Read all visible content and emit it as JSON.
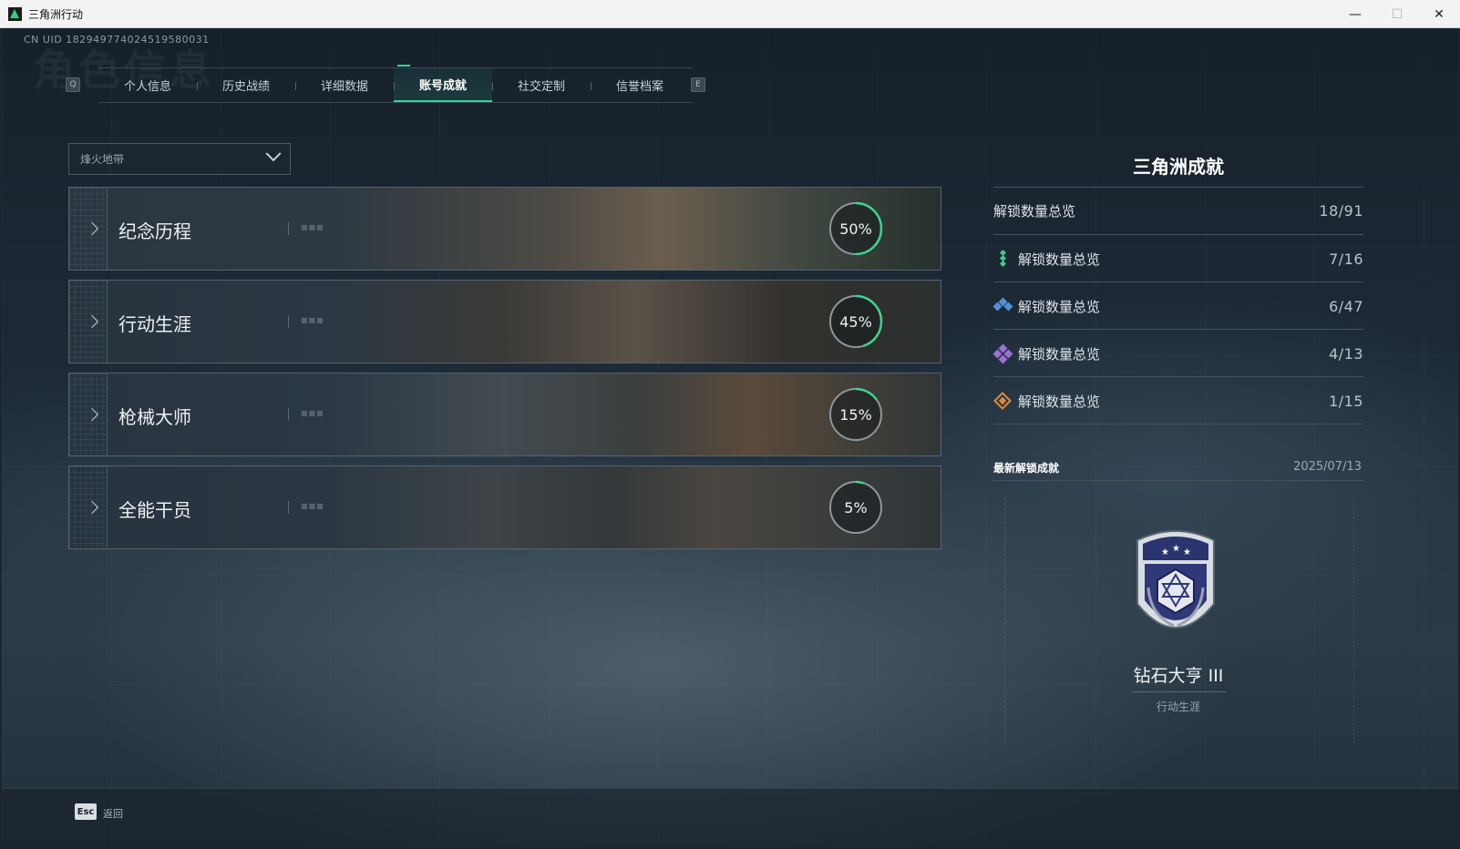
{
  "window": {
    "title": "三角洲行动",
    "minimize": "—",
    "maximize": "☐",
    "close": "✕"
  },
  "header": {
    "uid": "CN UID 182949774024519580031",
    "watermark": "角色信息",
    "key_left": "Q",
    "key_right": "E"
  },
  "tabs": [
    {
      "label": "个人信息",
      "active": false
    },
    {
      "label": "历史战绩",
      "active": false
    },
    {
      "label": "详细数据",
      "active": false
    },
    {
      "label": "账号成就",
      "active": true
    },
    {
      "label": "社交定制",
      "active": false
    },
    {
      "label": "信誉档案",
      "active": false
    }
  ],
  "filter": {
    "selected": "烽火地带"
  },
  "categories": [
    {
      "label": "纪念历程",
      "percent_text": "50%",
      "progress": 0.5
    },
    {
      "label": "行动生涯",
      "percent_text": "45%",
      "progress": 0.45
    },
    {
      "label": "枪械大师",
      "percent_text": "15%",
      "progress": 0.15
    },
    {
      "label": "全能干员",
      "percent_text": "5%",
      "progress": 0.05
    }
  ],
  "summary": {
    "title": "三角洲成就",
    "total": {
      "label": "解锁数量总览",
      "value": "18/91"
    },
    "tiers": [
      {
        "label": "解锁数量总览",
        "value": "7/16",
        "color": "#3ec98a",
        "icon": "green-gem-icon"
      },
      {
        "label": "解锁数量总览",
        "value": "6/47",
        "color": "#4f8fd6",
        "icon": "blue-gem-icon"
      },
      {
        "label": "解锁数量总览",
        "value": "4/13",
        "color": "#9c6fd6",
        "icon": "purple-gem-icon"
      },
      {
        "label": "解锁数量总览",
        "value": "1/15",
        "color": "#e08a3c",
        "icon": "orange-gem-icon"
      }
    ]
  },
  "latest": {
    "title": "最新解锁成就",
    "date": "2025/07/13",
    "badge_name": "钻石大亨 III",
    "badge_category": "行动生涯"
  },
  "footer": {
    "esc_key": "Esc",
    "back_label": "返回"
  }
}
